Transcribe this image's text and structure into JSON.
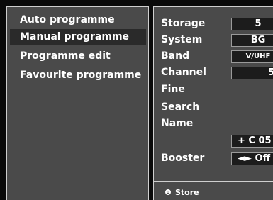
{
  "menu": {
    "items": [
      {
        "label": "Auto programme"
      },
      {
        "label": "Manual programme"
      },
      {
        "label": "Programme edit"
      },
      {
        "label": "Favourite programme"
      }
    ]
  },
  "settings": {
    "storage": {
      "label": "Storage",
      "value": "5"
    },
    "system": {
      "label": "System",
      "value": "BG"
    },
    "band": {
      "label": "Band",
      "value": "V/UHF"
    },
    "channel": {
      "label": "Channel",
      "value": "5"
    },
    "fine": {
      "label": "Fine"
    },
    "search": {
      "label": "Search"
    },
    "name": {
      "label": "Name",
      "value": "+ C 05"
    },
    "booster": {
      "label": "Booster",
      "value": "◄► Off"
    }
  },
  "footer": {
    "store_label": "Store"
  }
}
